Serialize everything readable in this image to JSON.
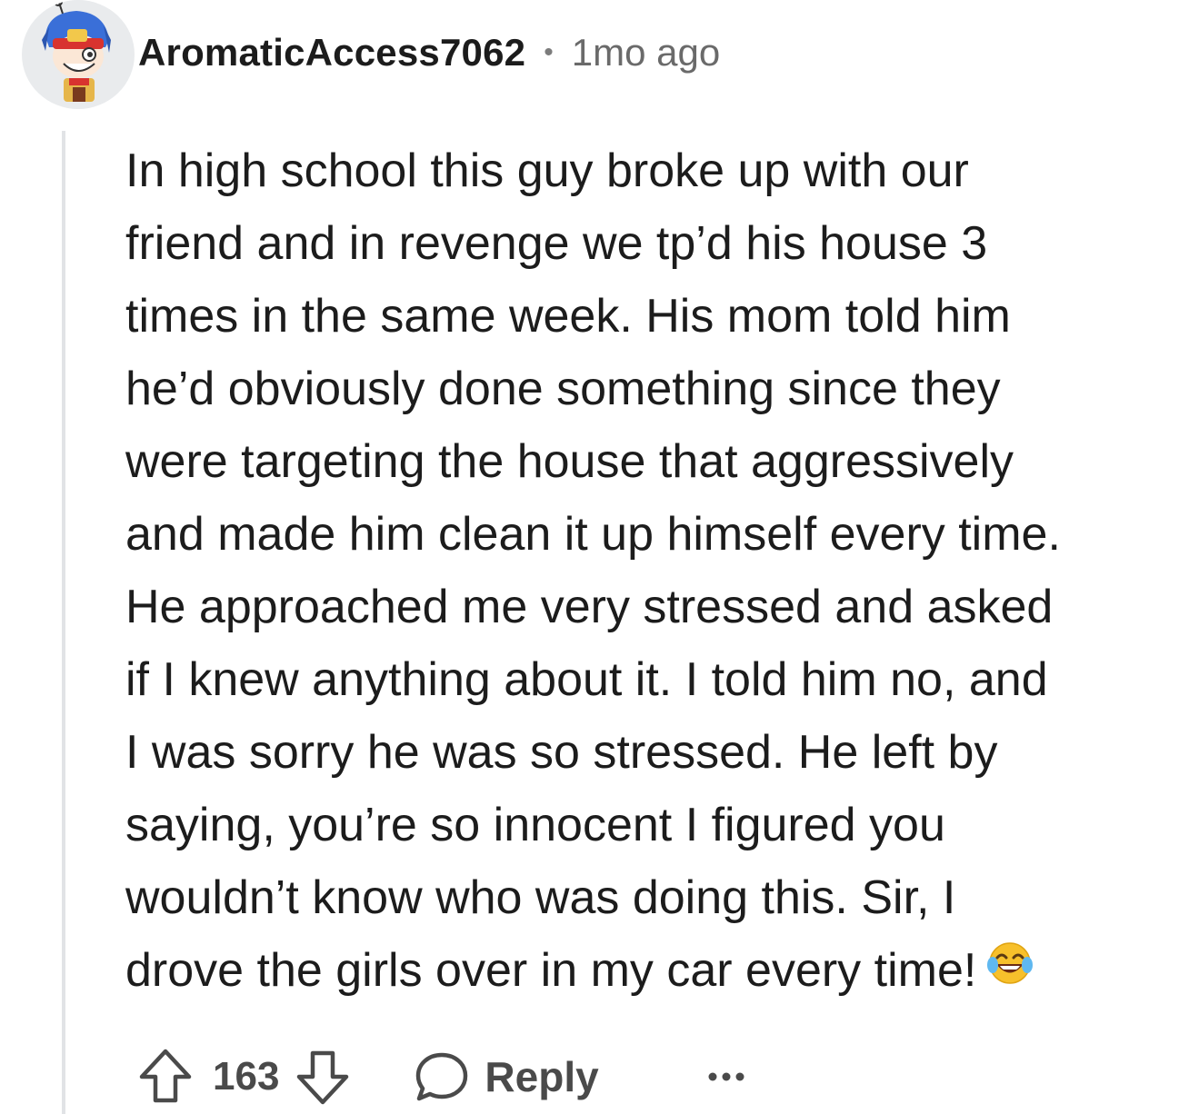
{
  "comment": {
    "username": "AromaticAccess7062",
    "separator": "•",
    "timestamp": "1mo ago",
    "body_lines": [
      "In high school this guy broke up with our",
      "friend and in revenge we tp’d his house 3",
      "times in the same week. His mom told him",
      "he’d obviously done something since they",
      "were targeting the house that aggressively",
      "and made him clean it up himself every time.",
      "He approached me very stressed and asked",
      "if I knew anything about it. I told him no, and",
      "I was sorry he was so stressed. He left by",
      "saying, you’re so innocent I figured you",
      "wouldn’t know who was doing this. Sir, I",
      "drove the girls over in my car every time!"
    ],
    "emoji": "laughing-tears-emoji"
  },
  "actions": {
    "vote_count": "163",
    "upvote_icon": "arrow-up-icon",
    "downvote_icon": "arrow-down-icon",
    "reply_icon": "speech-bubble-icon",
    "reply_label": "Reply",
    "more_icon": "ellipsis-icon"
  },
  "colors": {
    "text": "#1c1c1c",
    "muted": "#6a6a6a",
    "action": "#4a4a4a",
    "thread_line": "#e1e3e6"
  }
}
